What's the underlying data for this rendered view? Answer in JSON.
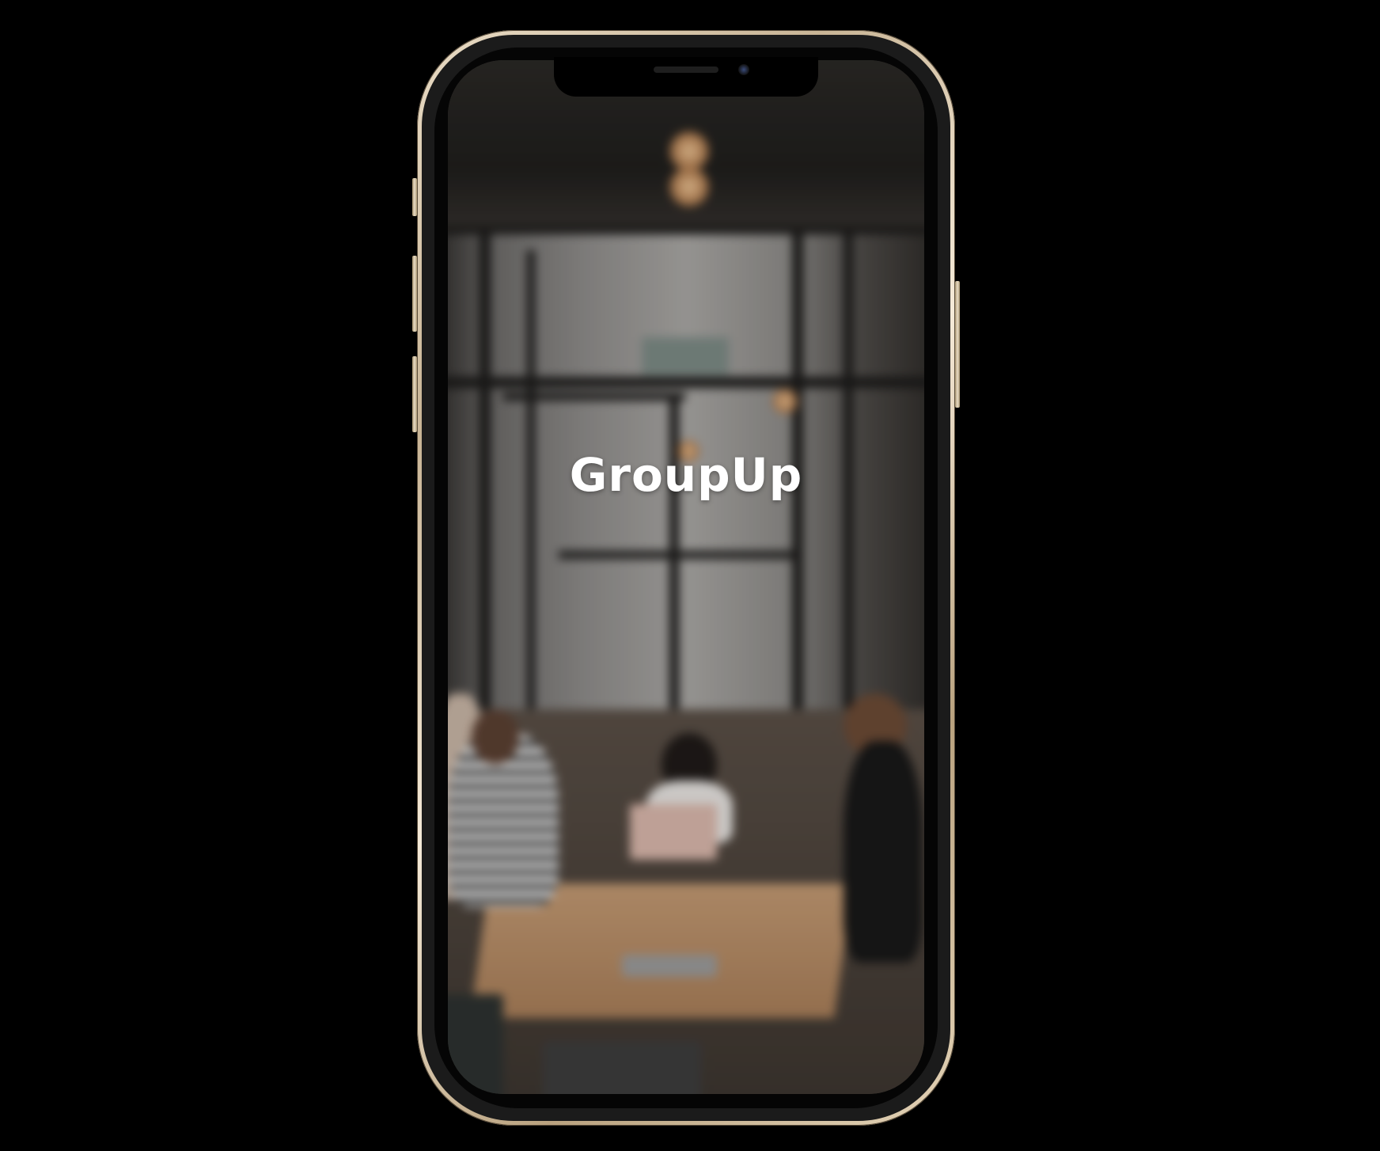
{
  "app": {
    "title": "GroupUp"
  },
  "device": {
    "frame_color": "#d9c9ad",
    "background_color": "#000000"
  },
  "screen": {
    "background_description_icon": "blurred-photo-background"
  }
}
